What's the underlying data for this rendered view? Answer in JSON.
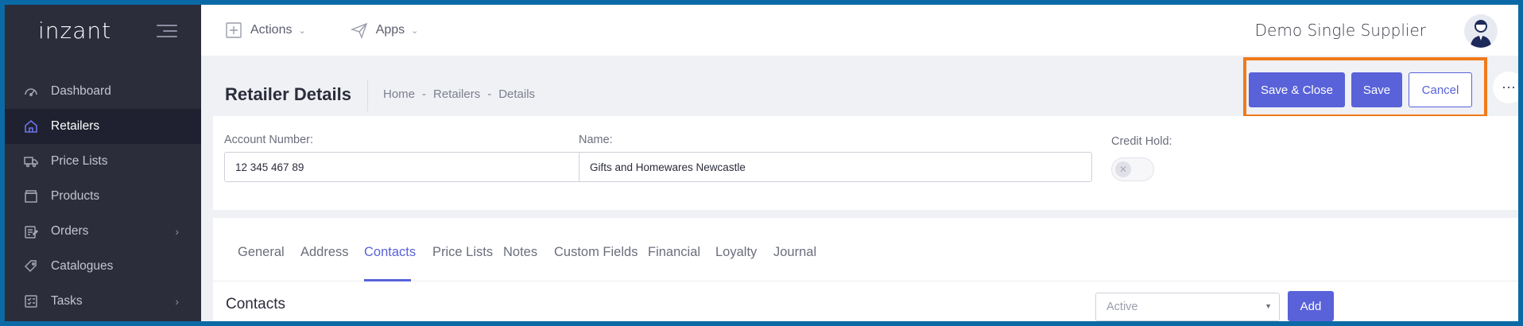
{
  "sidebar": {
    "logo": "inzant",
    "items": [
      {
        "label": "Dashboard",
        "icon": "dashboard-icon"
      },
      {
        "label": "Retailers",
        "icon": "home-icon",
        "active": true
      },
      {
        "label": "Price Lists",
        "icon": "truck-icon"
      },
      {
        "label": "Products",
        "icon": "box-icon"
      },
      {
        "label": "Orders",
        "icon": "clipboard-icon",
        "chevron": "›"
      },
      {
        "label": "Catalogues",
        "icon": "tag-icon"
      },
      {
        "label": "Tasks",
        "icon": "checklist-icon",
        "chevron": "›"
      }
    ]
  },
  "topbar": {
    "actions_label": "Actions",
    "apps_label": "Apps",
    "username": "Demo Single Supplier"
  },
  "header": {
    "title": "Retailer Details",
    "breadcrumb": [
      "Home",
      "-",
      "Retailers",
      "-",
      "Details"
    ],
    "save_close_label": "Save & Close",
    "save_label": "Save",
    "cancel_label": "Cancel",
    "more_label": "⋯"
  },
  "form": {
    "account_number_label": "Account Number:",
    "account_number_value": "12 345 467 89",
    "name_label": "Name:",
    "name_value": "Gifts and Homewares Newcastle",
    "credit_hold_label": "Credit Hold:",
    "credit_hold_on": false
  },
  "tabs": [
    "General",
    "Address",
    "Contacts",
    "Price Lists",
    "Notes",
    "Custom Fields",
    "Financial",
    "Loyalty",
    "Journal"
  ],
  "active_tab": "Contacts",
  "contacts": {
    "title": "Contacts",
    "filter_value": "Active",
    "add_label": "Add"
  },
  "colors": {
    "accent": "#5962d8",
    "sidebar_bg": "#2b2d3b",
    "highlight": "#f07a1a"
  }
}
